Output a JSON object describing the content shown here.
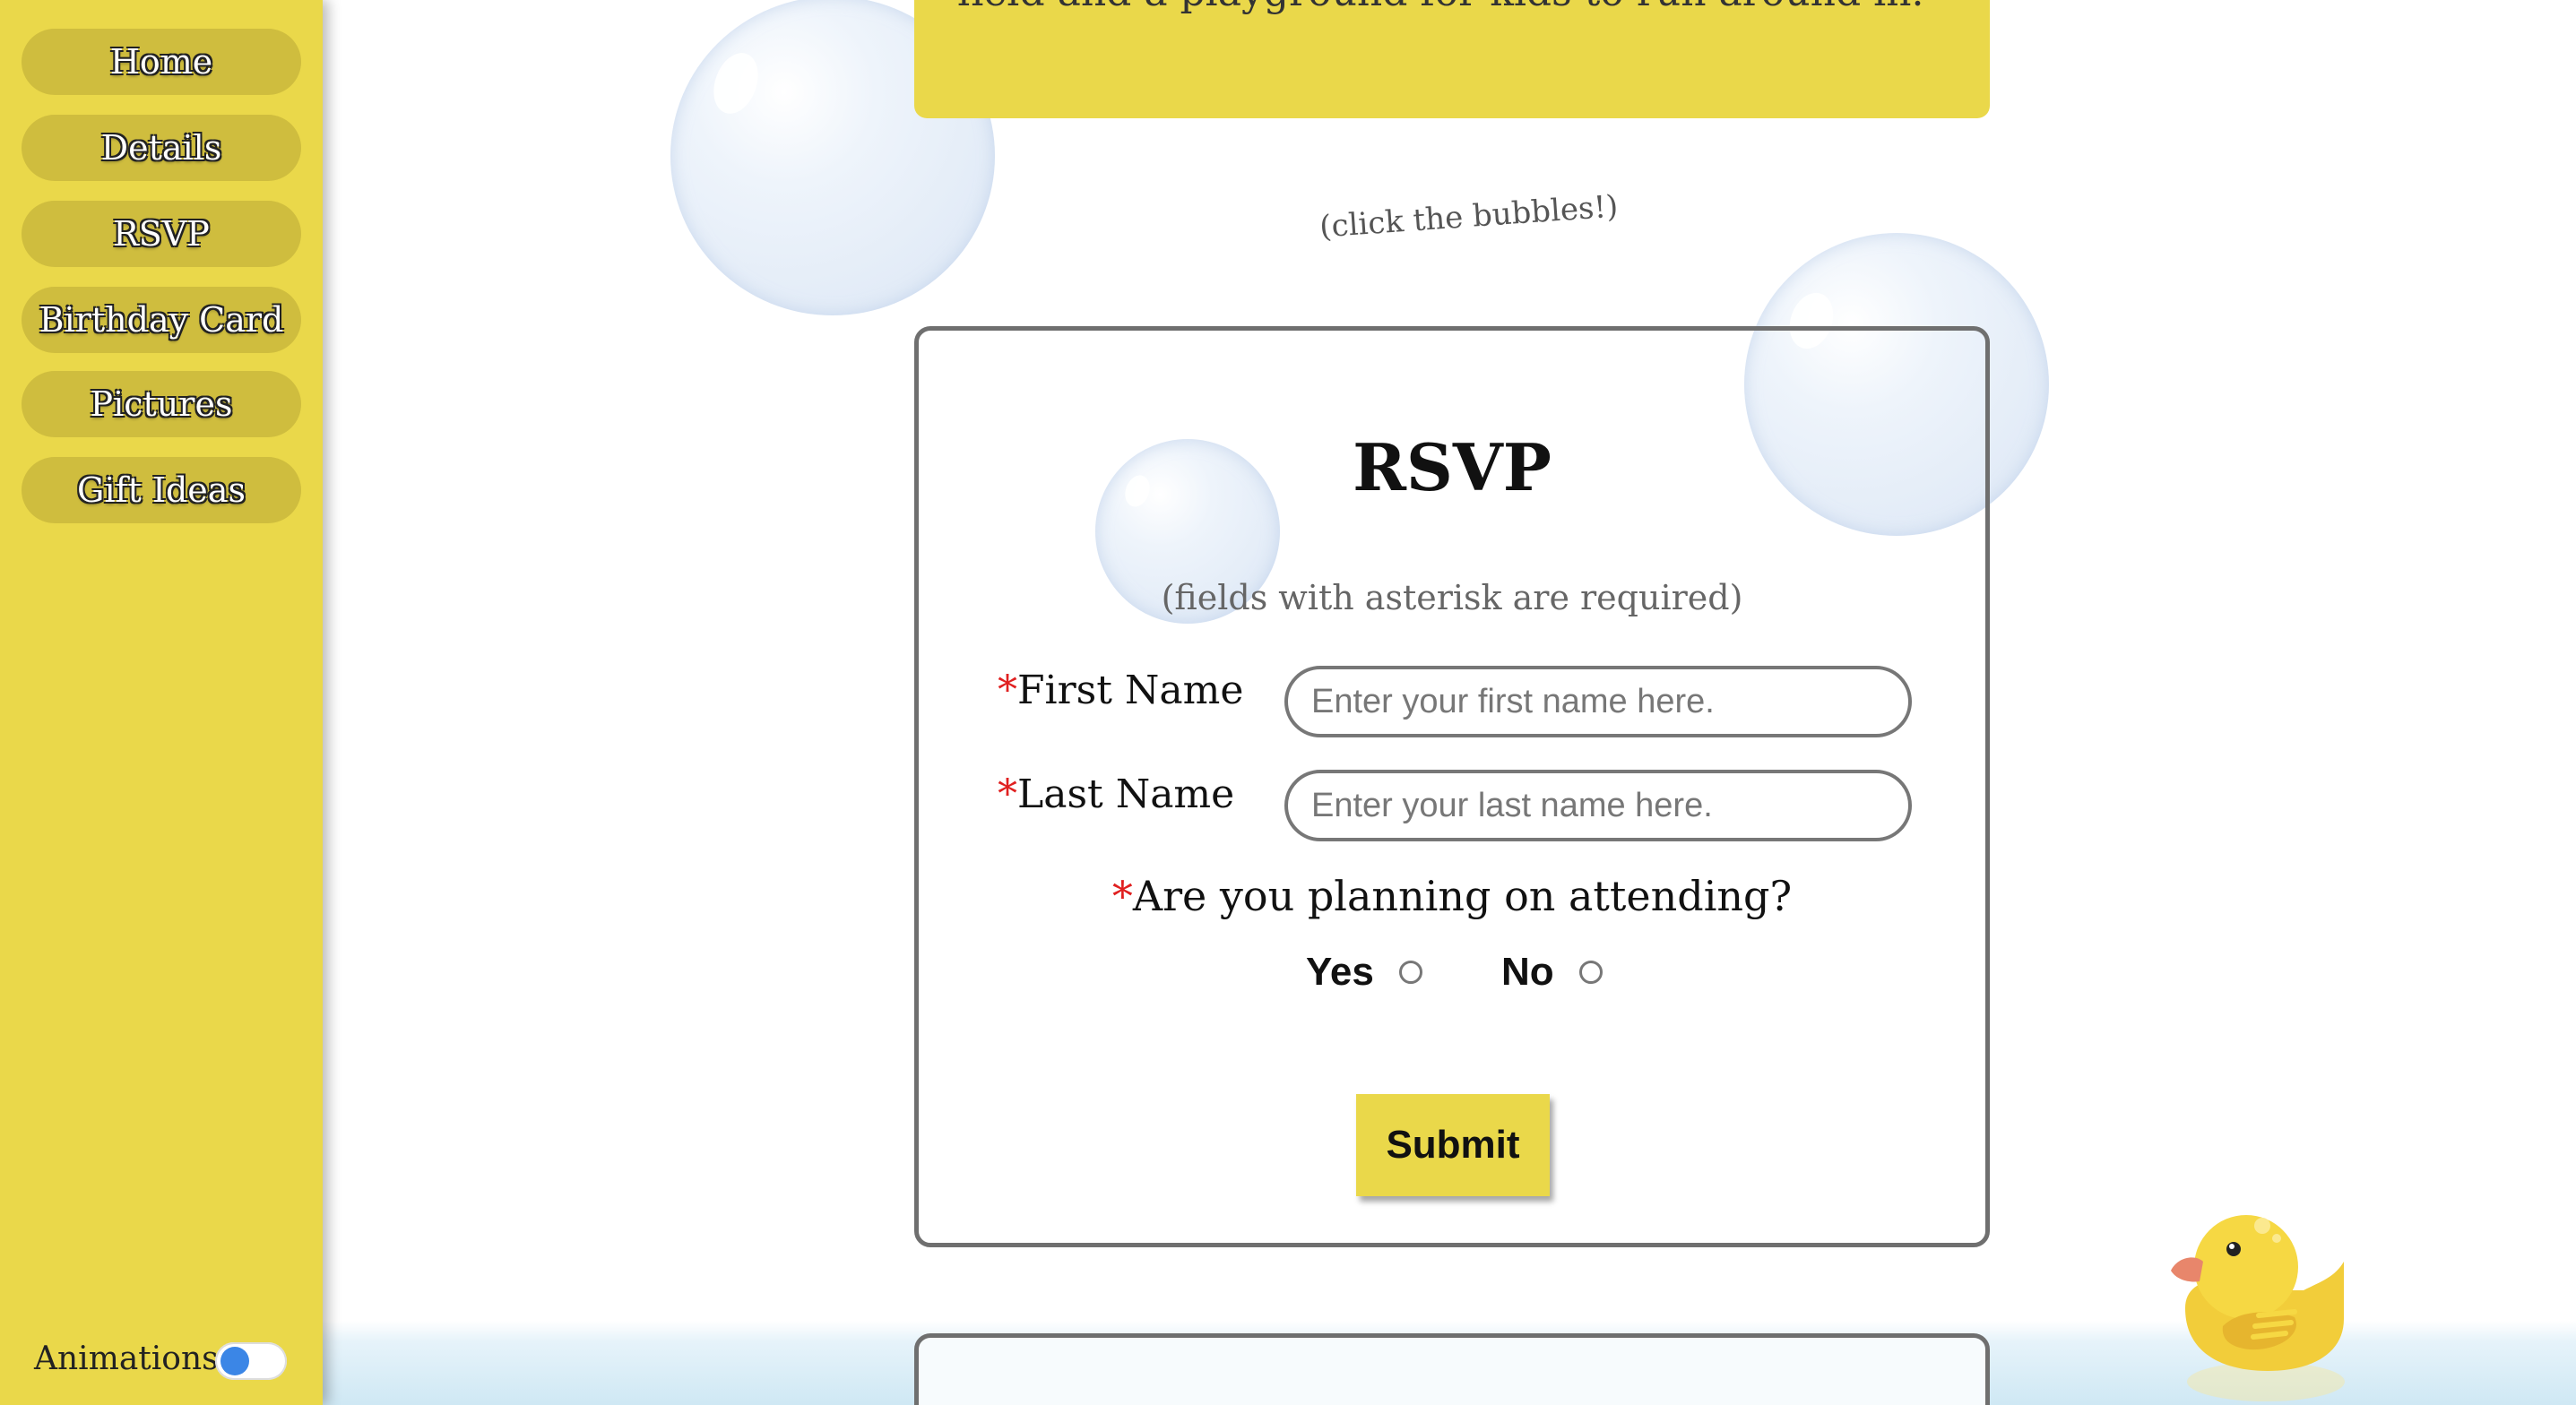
{
  "sidebar": {
    "items": [
      {
        "label": "Home"
      },
      {
        "label": "Details"
      },
      {
        "label": "RSVP"
      },
      {
        "label": "Birthday Card"
      },
      {
        "label": "Pictures"
      },
      {
        "label": "Gift Ideas"
      }
    ],
    "animations_label": "Animations:",
    "animations_on": false
  },
  "top_card": {
    "text": "field and a playground for kids to run around in."
  },
  "hint": "(click the bubbles!)",
  "rsvp": {
    "title": "RSVP",
    "subtitle": "(fields with asterisk are required)",
    "required_mark": "*",
    "first_name": {
      "label": "First Name",
      "placeholder": "Enter your first name here.",
      "value": ""
    },
    "last_name": {
      "label": "Last Name",
      "placeholder": "Enter your last name here.",
      "value": ""
    },
    "question": "Are you planning on attending?",
    "options": [
      {
        "label": "Yes",
        "checked": false
      },
      {
        "label": "No",
        "checked": false
      }
    ],
    "submit_label": "Submit"
  },
  "colors": {
    "accent_yellow": "#ead84a",
    "border_gray": "#6f6f6f",
    "required_red": "#e02020",
    "toggle_blue": "#3b86e6"
  }
}
